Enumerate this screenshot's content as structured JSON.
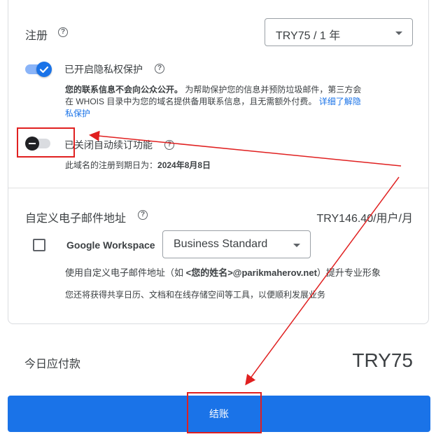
{
  "registration": {
    "label": "注册",
    "select_value": "TRY75 / 1 年"
  },
  "privacy": {
    "toggle_label": "已开启隐私权保护",
    "desc_bold": "您的联系信息不会向公众公开。",
    "desc_text_1": "为帮助保护您的信息并预防垃圾邮件，第三方会",
    "desc_text_2": "在 WHOIS 目录中为您的域名提供备用联系信息，且无需额外付费。",
    "link_part_1": "详细了解隐",
    "link_part_2": "私保护",
    "enabled": true
  },
  "auto_renew": {
    "toggle_label": "已关闭自动续订功能",
    "expiry_prefix": "此域名的注册到期日为：",
    "expiry_date": "2024年8月8日",
    "enabled": false
  },
  "email": {
    "title": "自定义电子邮件地址",
    "price": "TRY146.40/用户/月",
    "product_name": "Google Workspace",
    "plan_value": "Business Standard",
    "desc_1_prefix": "使用自定义电子邮件地址（如 ",
    "desc_1_example": "<您的姓名>@parikmaherov.net",
    "desc_1_suffix": "）提升专业形象",
    "desc_2": "您还将获得共享日历、文档和在线存储空间等工具，以便顺利发展业务",
    "checked": false
  },
  "summary": {
    "label": "今日应付款",
    "amount": "TRY75"
  },
  "checkout": {
    "label": "结账"
  },
  "colors": {
    "accent": "#1a73e8",
    "annotation": "#e02020"
  }
}
